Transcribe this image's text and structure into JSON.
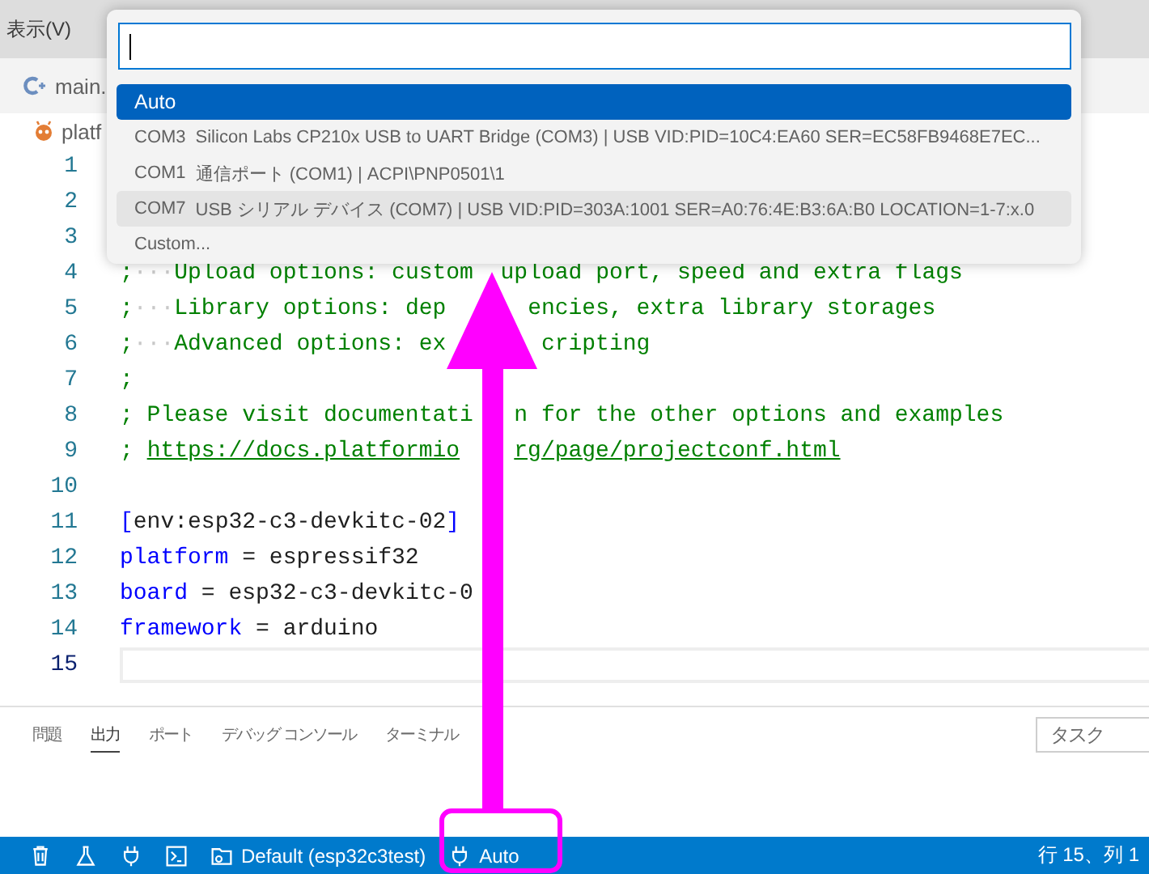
{
  "menu_bar": {
    "menu": "表示(V)"
  },
  "editor_tab": {
    "label": "main."
  },
  "breadcrumb": {
    "label": "platf"
  },
  "quick_pick": {
    "items": [
      {
        "label": "Auto",
        "selected": true,
        "hovered": false
      },
      {
        "label": "COM3",
        "detail": "Silicon Labs CP210x USB to UART Bridge (COM3) | USB VID:PID=10C4:EA60 SER=EC58FB9468E7EC...",
        "selected": false,
        "hovered": false
      },
      {
        "label": "COM1",
        "detail": "通信ポート (COM1) | ACPI\\PNP0501\\1",
        "selected": false,
        "hovered": false
      },
      {
        "label": "COM7",
        "detail": "USB シリアル デバイス (COM7) | USB VID:PID=303A:1001 SER=A0:76:4E:B3:6A:B0 LOCATION=1-7:x.0",
        "selected": false,
        "hovered": true
      },
      {
        "label": "Custom...",
        "selected": false,
        "hovered": false
      }
    ]
  },
  "editor_lines": [
    {
      "number": "1",
      "current": false
    },
    {
      "number": "2",
      "current": false
    },
    {
      "number": "3",
      "current": false
    },
    {
      "number": "4",
      "current": false,
      "parts": [
        [
          {
            "text": ";",
            "kind": "comment"
          },
          {
            "text": "···",
            "kind": "ws"
          },
          {
            "text": "Upload options: custom",
            "kind": "comment"
          }
        ],
        [
          {
            "text": "upload port, speed and extra flags",
            "kind": "comment"
          }
        ]
      ]
    },
    {
      "number": "5",
      "current": false,
      "parts": [
        [
          {
            "text": ";",
            "kind": "comment"
          },
          {
            "text": "···",
            "kind": "ws"
          },
          {
            "text": "Library options: dep",
            "kind": "comment"
          }
        ],
        [
          {
            "text": "encies, extra library storages",
            "kind": "comment"
          }
        ]
      ]
    },
    {
      "number": "6",
      "current": false,
      "parts": [
        [
          {
            "text": ";",
            "kind": "comment"
          },
          {
            "text": "···",
            "kind": "ws"
          },
          {
            "text": "Advanced options: ex",
            "kind": "comment"
          }
        ],
        [
          {
            "text": "cripting",
            "kind": "comment"
          }
        ]
      ]
    },
    {
      "number": "7",
      "current": false,
      "parts": [
        [
          {
            "text": ";",
            "kind": "comment"
          }
        ]
      ]
    },
    {
      "number": "8",
      "current": false,
      "parts": [
        [
          {
            "text": "; Please visit documentati",
            "kind": "comment"
          }
        ],
        [
          {
            "text": "n for the other options and examples",
            "kind": "comment"
          }
        ]
      ]
    },
    {
      "number": "9",
      "current": false,
      "parts": [
        [
          {
            "text": "; ",
            "kind": "comment"
          },
          {
            "text": "https://docs.platformio",
            "kind": "link"
          }
        ],
        [
          {
            "text": "rg/page/projectconf.html",
            "kind": "link"
          }
        ]
      ]
    },
    {
      "number": "10",
      "current": false
    },
    {
      "number": "11",
      "current": false,
      "parts": [
        [
          {
            "text": "[",
            "kind": "bracket"
          },
          {
            "text": "env:esp32-c3-devkitc-02",
            "kind": "section"
          },
          {
            "text": "]",
            "kind": "bracket"
          }
        ]
      ]
    },
    {
      "number": "12",
      "current": false,
      "parts": [
        [
          {
            "text": "platform",
            "kind": "key"
          },
          {
            "text": " = espressif32",
            "kind": "plain"
          }
        ]
      ]
    },
    {
      "number": "13",
      "current": false,
      "parts": [
        [
          {
            "text": "board",
            "kind": "key"
          },
          {
            "text": " = esp32-c3-devkitc-0",
            "kind": "plain"
          }
        ]
      ]
    },
    {
      "number": "14",
      "current": false,
      "parts": [
        [
          {
            "text": "framework",
            "kind": "key"
          },
          {
            "text": " = arduino",
            "kind": "plain"
          }
        ]
      ]
    },
    {
      "number": "15",
      "current": true
    }
  ],
  "panel": {
    "tabs": [
      {
        "label": "問題",
        "selected": false
      },
      {
        "label": "出力",
        "selected": true
      },
      {
        "label": "ポート",
        "selected": false
      },
      {
        "label": "デバッグ コンソール",
        "selected": false
      },
      {
        "label": "ターミナル",
        "selected": false
      }
    ],
    "task_dropdown": "タスク"
  },
  "status_bar": {
    "items": [
      {
        "kind": "trash"
      },
      {
        "kind": "flask"
      },
      {
        "kind": "plug"
      },
      {
        "kind": "terminal"
      },
      {
        "kind": "env",
        "text": "Default (esp32c3test)"
      },
      {
        "kind": "plug",
        "text": "Auto"
      }
    ],
    "position": "行 15、列 1"
  }
}
